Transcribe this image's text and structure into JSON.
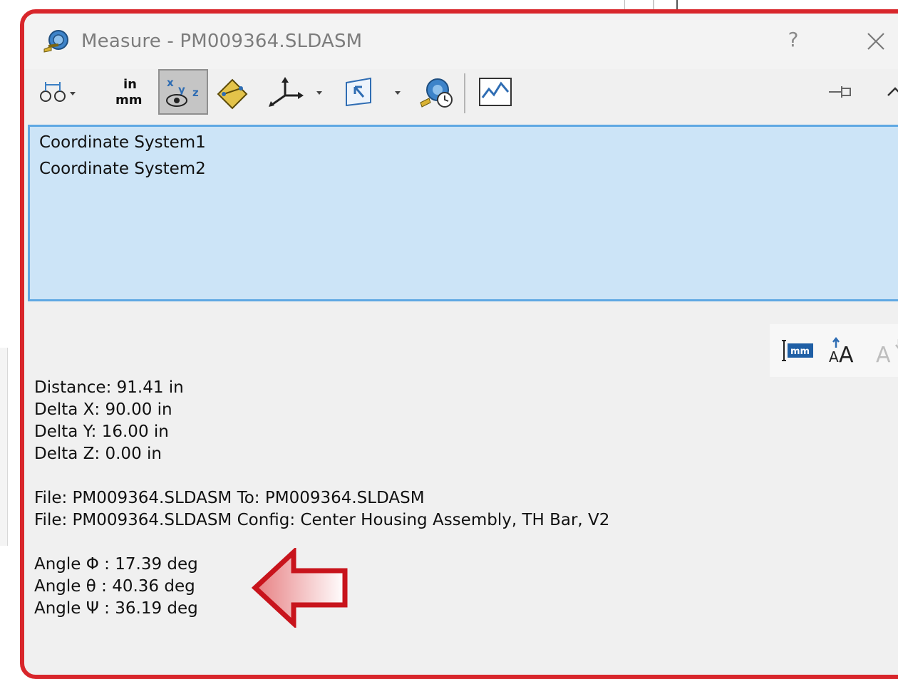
{
  "dialog": {
    "title": "Measure - PM009364.SLDASM",
    "help_label": "?",
    "close_icon": "close-icon",
    "app_icon": "measure-tape-icon"
  },
  "toolbar": {
    "items": [
      {
        "icon": "arc-circle-measure-icon",
        "has_dropdown": true
      },
      {
        "icon": "units-precision-icon",
        "label_top": "in",
        "label_bottom": "mm"
      },
      {
        "icon": "show-xyz-measurements-icon",
        "active": true
      },
      {
        "icon": "point-to-point-icon"
      },
      {
        "icon": "projection-axes-icon",
        "has_dropdown": true
      },
      {
        "icon": "select-coordinate-system-icon",
        "has_dropdown": true
      },
      {
        "icon": "measurement-history-icon"
      },
      {
        "icon": "create-sensor-icon"
      }
    ],
    "right_icons": [
      "pin-icon",
      "collapse-chevron-icon"
    ]
  },
  "selection": {
    "items": [
      "Coordinate System1",
      "Coordinate System2"
    ]
  },
  "mini_toolbar": {
    "icons": [
      "dimension-units-icon",
      "increase-text-size-icon",
      "decrease-text-size-icon"
    ]
  },
  "results": {
    "distance": "Distance: 91.41 in",
    "delta_x": "Delta X: 90.00 in",
    "delta_y": "Delta Y: 16.00 in",
    "delta_z": "Delta Z: 0.00 in",
    "file_line1": "File: PM009364.SLDASM To: PM009364.SLDASM",
    "file_line2": "File: PM009364.SLDASM Config: Center Housing Assembly, TH Bar, V2",
    "angle_phi": "Angle Φ : 17.39 deg",
    "angle_theta": "Angle θ : 40.36 deg",
    "angle_psi": "Angle Ψ : 36.19 deg"
  },
  "annotation": {
    "icon": "left-arrow-callout-icon",
    "color": "#c8141c"
  },
  "colors": {
    "highlight_border": "#d8262b",
    "selection_bg": "#cce4f7",
    "selection_border": "#5fa8e3"
  }
}
